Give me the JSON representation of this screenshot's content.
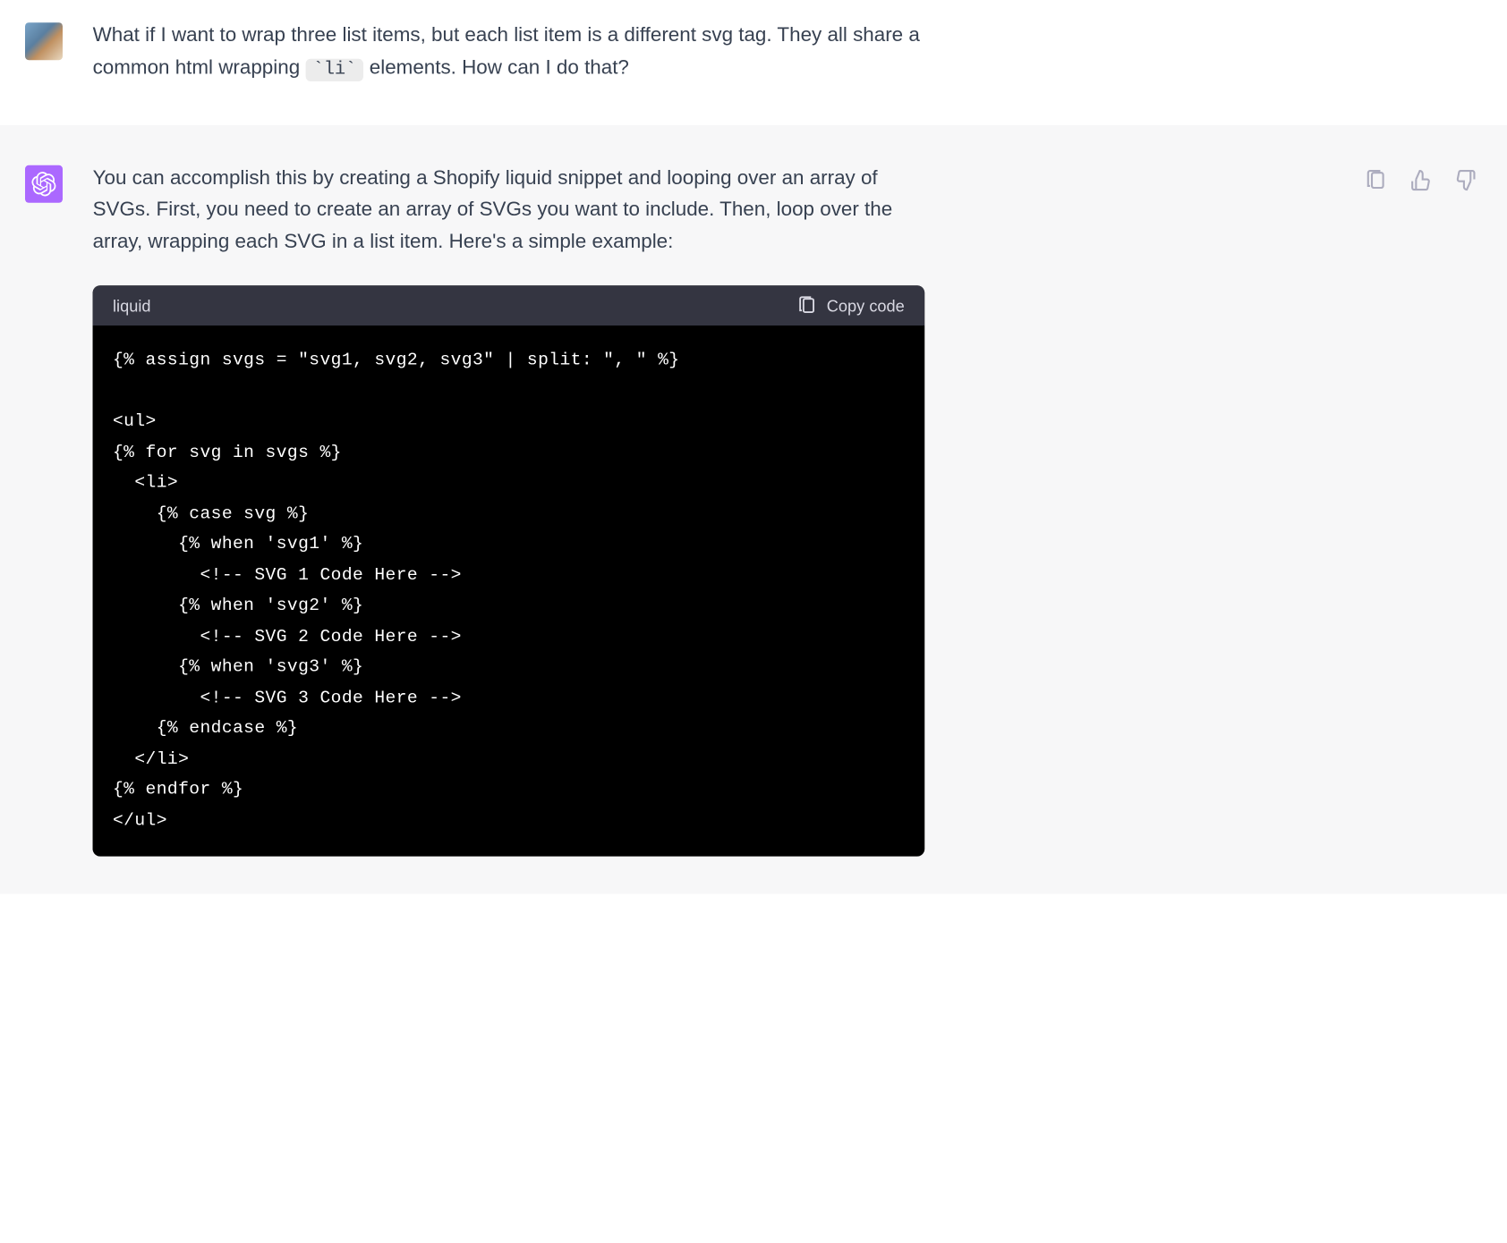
{
  "user_message": {
    "text_before_code": "What if I want to wrap three list items, but each list item is a different svg tag. They all share a common html wrapping ",
    "inline_code": "`li`",
    "text_after_code": " elements. How can I do that?"
  },
  "assistant_message": {
    "intro": "You can accomplish this by creating a Shopify liquid snippet and looping over an array of SVGs. First, you need to create an array of SVGs you want to include. Then, loop over the array, wrapping each SVG in a list item. Here's a simple example:"
  },
  "code_block": {
    "language": "liquid",
    "copy_label": "Copy code",
    "code": "{% assign svgs = \"svg1, svg2, svg3\" | split: \", \" %}\n\n<ul>\n{% for svg in svgs %}\n  <li>\n    {% case svg %}\n      {% when 'svg1' %}\n        <!-- SVG 1 Code Here -->\n      {% when 'svg2' %}\n        <!-- SVG 2 Code Here -->\n      {% when 'svg3' %}\n        <!-- SVG 3 Code Here -->\n    {% endcase %}\n  </li>\n{% endfor %}\n</ul>"
  },
  "actions": {
    "copy": "copy",
    "thumbs_up": "thumbs-up",
    "thumbs_down": "thumbs-down"
  }
}
